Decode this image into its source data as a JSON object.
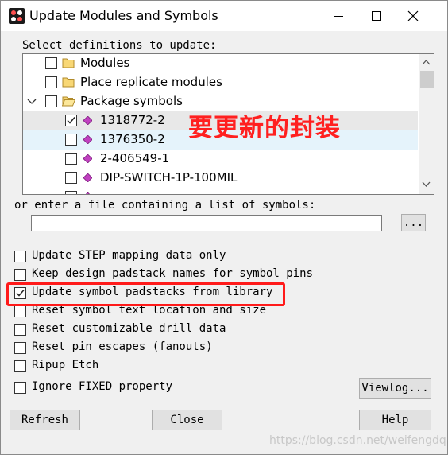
{
  "window": {
    "title": "Update Modules and Symbols",
    "minimize_icon": "minimize-icon",
    "maximize_icon": "maximize-icon",
    "close_icon": "close-icon"
  },
  "definitions": {
    "label": "Select definitions to update:",
    "tree": [
      {
        "label": "Modules",
        "checked": false,
        "icon": "folder-icon",
        "level": 1
      },
      {
        "label": "Place replicate modules",
        "checked": false,
        "icon": "folder-icon",
        "level": 1
      },
      {
        "label": "Package symbols",
        "checked": false,
        "icon": "open-folder-icon",
        "level": 1,
        "expanded": true
      },
      {
        "label": "1318772-2",
        "checked": true,
        "icon": "symbol-icon",
        "level": 2,
        "selected": true
      },
      {
        "label": "1376350-2",
        "checked": false,
        "icon": "symbol-icon",
        "level": 2,
        "hover": true
      },
      {
        "label": "2-406549-1",
        "checked": false,
        "icon": "symbol-icon",
        "level": 2
      },
      {
        "label": "DIP-SWITCH-1P-100MIL",
        "checked": false,
        "icon": "symbol-icon",
        "level": 2
      }
    ]
  },
  "annotation": "要更新的封装",
  "file": {
    "label": "or enter a file containing a list of symbols:",
    "value": "",
    "browse_label": "..."
  },
  "options": [
    {
      "label": "Update STEP mapping data only",
      "checked": false
    },
    {
      "label": "Keep design padstack names for symbol pins",
      "checked": false
    },
    {
      "label": "Update symbol padstacks from library",
      "checked": true
    },
    {
      "label": "Reset symbol text location and size",
      "checked": false
    },
    {
      "label": "Reset customizable drill data",
      "checked": false
    },
    {
      "label": "Reset pin escapes (fanouts)",
      "checked": false
    },
    {
      "label": "Ripup Etch",
      "checked": false
    },
    {
      "label": "Ignore FIXED property",
      "checked": false
    }
  ],
  "buttons": {
    "viewlog": "Viewlog...",
    "refresh": "Refresh",
    "close": "Close",
    "help": "Help"
  },
  "watermark": "https://blog.csdn.net/weifengdq",
  "colors": {
    "highlight": "#ff1a1a",
    "selected_row": "#e8e8e8",
    "hover_row": "#e5f3fb",
    "symbol": "#c040c0",
    "folder": "#f8d775"
  }
}
